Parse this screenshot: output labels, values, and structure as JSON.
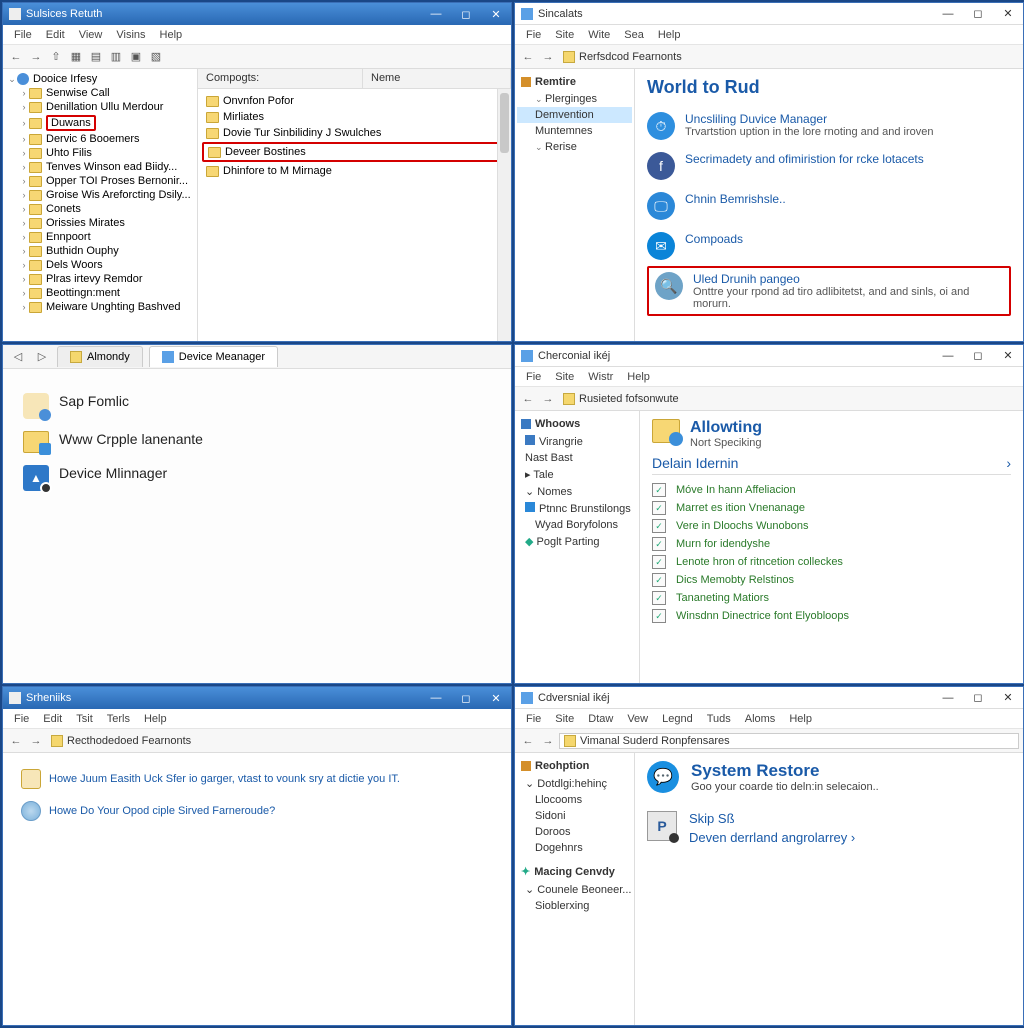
{
  "windows": {
    "tl": {
      "title": "Sulsices Retuth",
      "menubar": [
        "File",
        "Edit",
        "View",
        "Visins",
        "Help"
      ],
      "tree_root": "Dooice Irfesy",
      "tree": [
        "Senwise Call",
        "Denillation Ullu Merdour",
        "Duwans",
        "Dervic 6 Booemers",
        "Uhto Filis",
        "Tenves Winson ead Biidy...",
        "Opper TOI Proses Bernonir...",
        "Groise Wis Areforcting Dsily...",
        "Conets",
        "Orissies Mirates",
        "Ennpoort",
        "Buthidn Ouphy",
        "Dels Woors",
        "Plras irtevy Remdor",
        "Beottingn:ment",
        "Meiware Unghting Bashved"
      ],
      "tree_highlight_index": 2,
      "columns": [
        "Compogts:",
        "Neme"
      ],
      "items": [
        "Onvnfon Pofor",
        "Mirliates",
        "Dovie Tur Sinbilidiny J Swulches",
        "Deveer Bostines",
        "Dhinfore to M Mirnage"
      ],
      "item_highlight_index": 3
    },
    "tr": {
      "title": "Sincalats",
      "menubar": [
        "Fie",
        "Site",
        "Wite",
        "Sea",
        "Help"
      ],
      "address": "Rerfsdcod Fearnonts",
      "nav_head": "Remtire",
      "nav_items": [
        "Plerginges",
        "Demvention",
        "Muntemnes",
        "Rerise"
      ],
      "nav_selected": 1,
      "heading": "World to Rud",
      "rows": [
        {
          "icon": "#2e8fdf",
          "glyph": "⏱",
          "title": "Uncsliling Duvice Manager",
          "sub": "Trvartstion uption in the lore rnoting and and iroven"
        },
        {
          "icon": "#3b5998",
          "glyph": "f",
          "title": "Secrimadety and ofimiristion for rcke lotacets",
          "sub": ""
        },
        {
          "icon": "#2b88d8",
          "glyph": "🖵",
          "title": "Chnin Bemrishsle..",
          "sub": ""
        },
        {
          "icon": "#0a84d8",
          "glyph": "✉",
          "title": "Compoads",
          "sub": ""
        },
        {
          "icon": "#6ea3c7",
          "glyph": "🔍",
          "title": "Uled Drunih pangeo",
          "sub": "Onttre your rpond ad tiro adlibitetst, and and sinls, oi and morurn.",
          "boxed": true
        }
      ]
    },
    "ml": {
      "tabs": [
        "Almondy",
        "Device Meanager"
      ],
      "items": [
        {
          "label": "Sap Fomlic"
        },
        {
          "label": "Www Crpple lanenante"
        },
        {
          "label": "Device Mlinnager"
        }
      ]
    },
    "mr": {
      "title": "Cherconial ikéj",
      "menubar": [
        "Fie",
        "Site",
        "Wistr",
        "Help"
      ],
      "address": "Rusieted fofsonwute",
      "nav_head": "Whoows",
      "nav_items_top": [
        "Virangrie"
      ],
      "nav_items_mid": [
        "Nast Bast",
        "Tale",
        "Nomes"
      ],
      "nav_items_bot": [
        "Ptnnc Brunstilongs",
        "Wyad Boryfolons",
        "Poglt Parting"
      ],
      "panel_title": "Allowting",
      "panel_sub": "Nort Speciking",
      "section": "Delain Idernin",
      "links": [
        "Móve In hann Affeliacion",
        "Marret es ition Vnenanage",
        "Vere in Dloochs Wunobons",
        "Murn for idendyshe",
        "Lenote hron of ritncetion colleckes",
        "Dics Memobty Relstinos",
        "Tananeting Matiors",
        "Winsdnn Dinectrice font Elyobloops"
      ]
    },
    "bl": {
      "title": "Srheniiks",
      "menubar": [
        "Fie",
        "Edit",
        "Tsit",
        "Terls",
        "Help"
      ],
      "address": "Recthodedoed Fearnonts",
      "questions": [
        "Howe Juum Easith Uck Sfer io garger, vtast to vounk sry at dictie you IT.",
        "Howe Do Your Opod ciple Sirved Farneroude?"
      ]
    },
    "br": {
      "title": "Cdversnial ikéj",
      "menubar": [
        "Fie",
        "Site",
        "Dtaw",
        "Vew",
        "Legnd",
        "Tuds",
        "Aloms",
        "Help"
      ],
      "address": "Vimanal Suderd Ronpfensares",
      "nav_head": "Reohption",
      "nav_group1": [
        "Dotdlgi:hehinç",
        "Llocooms",
        "Sidoni",
        "Doroos",
        "Dogehnrs"
      ],
      "nav_head2": "Macing Cenvdy",
      "nav_group2": [
        "Counele Beoneer...",
        "Sioblerxing"
      ],
      "title_main": "System Restore",
      "sub_main": "Goo your coarde tio deln:in selecaion..",
      "link1": "Skip Sß",
      "link2": "Deven derrland angrolarrey"
    }
  }
}
